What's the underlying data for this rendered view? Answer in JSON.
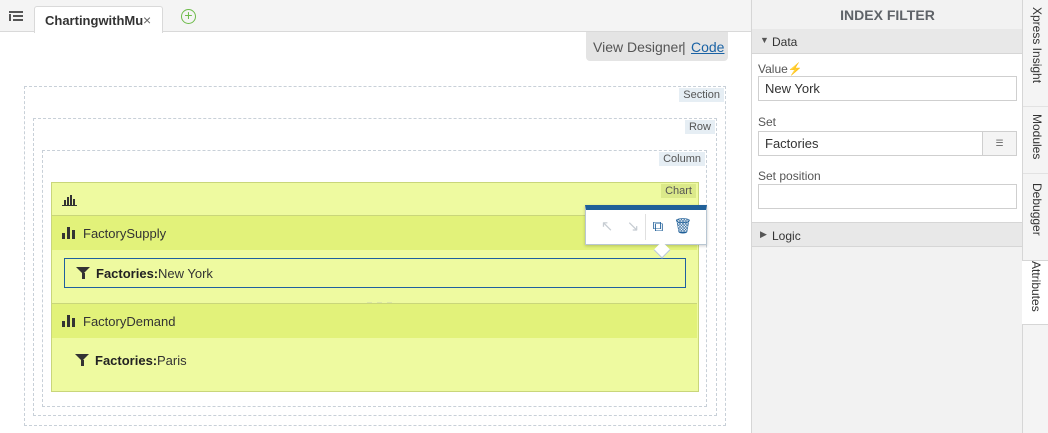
{
  "tabbar": {
    "tab_label": "ChartingwithMu",
    "tab_close": "×",
    "add_tab": "+"
  },
  "view_switch": {
    "designer_label": "View Designer",
    "separator": "|",
    "code_label": "Code"
  },
  "canvas": {
    "section_label": "Section",
    "row_label": "Row",
    "column_label": "Column",
    "chart_label": "Chart",
    "series": [
      {
        "name": "FactorySupply",
        "filter_key": "Factories:",
        "filter_value": "New York",
        "selected": true
      },
      {
        "name": "FactoryDemand",
        "filter_key": "Factories:",
        "filter_value": "Paris",
        "selected": false
      }
    ]
  },
  "toolbar": {
    "move_up_icon": "↖",
    "move_down_icon": "↘",
    "copy_icon": "⧉",
    "delete_icon": "🗑"
  },
  "panel": {
    "title": "INDEX FILTER",
    "data_section": "Data",
    "data_arrow": "▼",
    "value_label": "Value",
    "value_icon": "⚡",
    "value": "New York",
    "set_label": "Set",
    "set_value": "Factories",
    "set_picker_icon": "☰",
    "set_position_label": "Set position",
    "set_position_value": "",
    "logic_section": "Logic",
    "logic_arrow": "▶"
  },
  "side_tabs": [
    "Xpress Insight",
    "Modules",
    "Debugger",
    "Attributes"
  ],
  "colors": {
    "chart_bg": "#eefaa0",
    "series_bg": "#e2f27a",
    "selection_border": "#1f5fa0",
    "add_tab_green": "#6dbb4a",
    "link_blue": "#1a62a4"
  }
}
